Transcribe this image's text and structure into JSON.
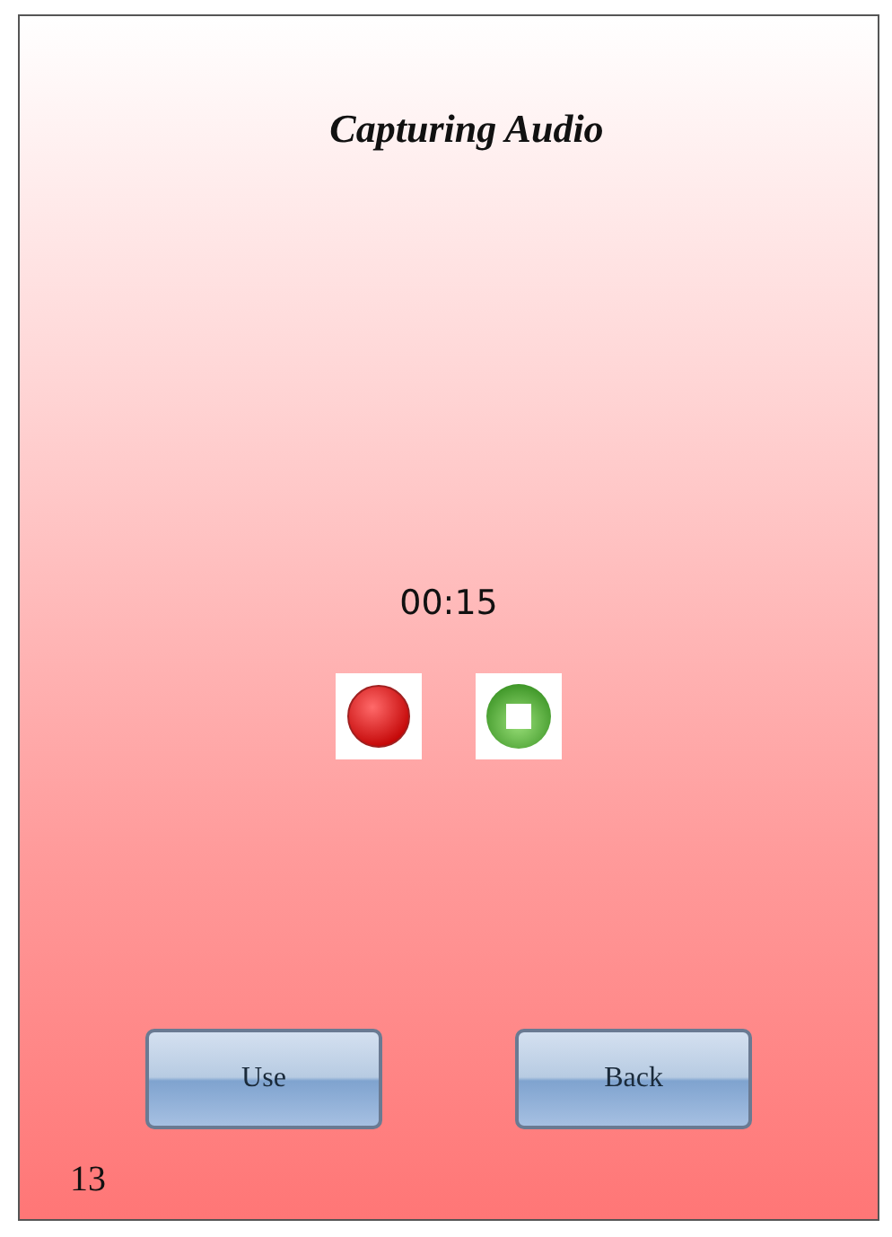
{
  "title": "Capturing Audio",
  "timer": "00:15",
  "controls": [
    {
      "kind": "record"
    },
    {
      "kind": "stop"
    }
  ],
  "buttons": [
    {
      "label": "Use"
    },
    {
      "label": "Back"
    }
  ],
  "page_number": "13"
}
